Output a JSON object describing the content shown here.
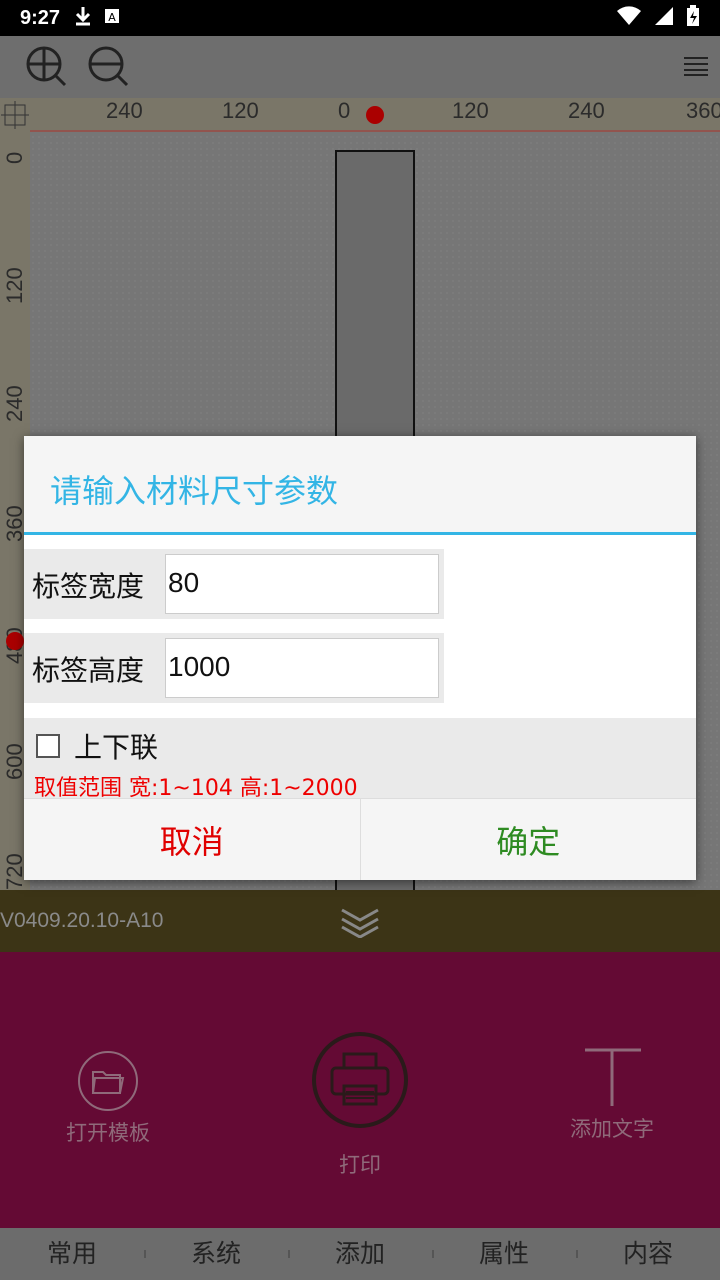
{
  "status": {
    "time": "9:27",
    "icons": [
      "download-icon",
      "a-icon",
      "wifi-icon",
      "signal-icon",
      "battery-icon"
    ]
  },
  "toolbar": {
    "icons": [
      "zoom-in-icon",
      "zoom-out-icon",
      "menu-icon"
    ]
  },
  "ruler": {
    "horizontal": [
      "240",
      "120",
      "0",
      "120",
      "240",
      "360"
    ],
    "vertical": [
      "0",
      "120",
      "240",
      "360",
      "480",
      "600",
      "720"
    ]
  },
  "dialog": {
    "title": "请输入材料尺寸参数",
    "width_label": "标签宽度",
    "width_value": "80",
    "height_label": "标签高度",
    "height_value": "1000",
    "checkbox_label": "上下联",
    "range_text": "取值范围 宽:1~104 高:1~2000",
    "cancel": "取消",
    "confirm": "确定"
  },
  "version": "V0409.20.10-A10",
  "panel": {
    "open_template": "打开模板",
    "print": "打印",
    "add_text": "添加文字"
  },
  "tabs": [
    "常用",
    "系统",
    "添加",
    "属性",
    "内容"
  ],
  "colors": {
    "accent": "#33b5e5",
    "cancel": "#e00000",
    "confirm": "#2e8b22",
    "panel": "#640a34"
  }
}
